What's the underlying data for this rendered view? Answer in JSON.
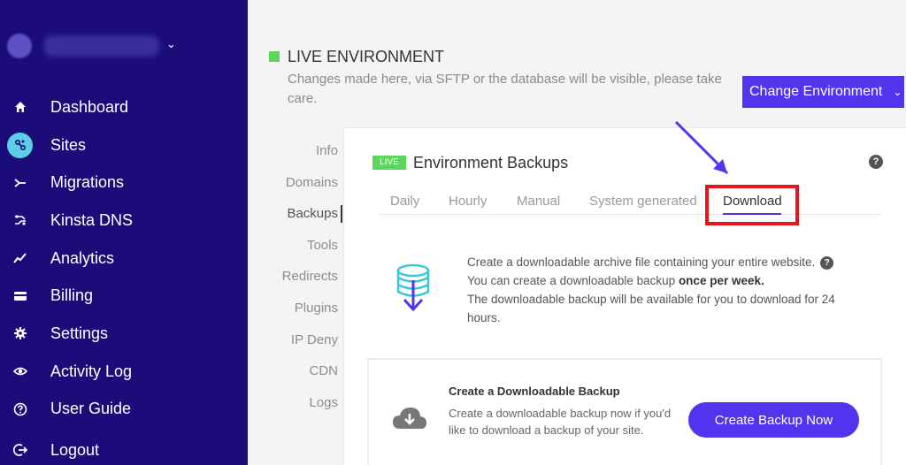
{
  "sidebar": {
    "items": [
      {
        "label": "Dashboard",
        "icon": "home-icon"
      },
      {
        "label": "Sites",
        "icon": "sites-icon",
        "active": true
      },
      {
        "label": "Migrations",
        "icon": "migrations-icon"
      },
      {
        "label": "Kinsta DNS",
        "icon": "dns-icon"
      },
      {
        "label": "Analytics",
        "icon": "analytics-icon"
      },
      {
        "label": "Billing",
        "icon": "billing-icon"
      },
      {
        "label": "Settings",
        "icon": "gear-icon"
      },
      {
        "label": "Activity Log",
        "icon": "eye-icon"
      },
      {
        "label": "User Guide",
        "icon": "question-icon"
      }
    ],
    "logout": "Logout"
  },
  "header": {
    "title": "LIVE ENVIRONMENT",
    "description": "Changes made here, via SFTP or the database will be visible, please take care.",
    "change_env": "Change Environment"
  },
  "subnav": [
    "Info",
    "Domains",
    "Backups",
    "Tools",
    "Redirects",
    "Plugins",
    "IP Deny",
    "CDN",
    "Logs"
  ],
  "card": {
    "badge": "LIVE",
    "title": "Environment Backups",
    "tabs": [
      "Daily",
      "Hourly",
      "Manual",
      "System generated",
      "Download"
    ],
    "info_line1": "Create a downloadable archive file containing your entire website.",
    "info_line2_pre": "You can create a downloadable backup ",
    "info_line2_bold": "once per week.",
    "info_line3": "The downloadable backup will be available for you to download for 24 hours.",
    "dl_title": "Create a Downloadable Backup",
    "dl_desc": "Create a downloadable backup now if you'd like to download a backup of your site.",
    "create_btn": "Create Backup Now"
  },
  "colors": {
    "sidebar": "#1c0c7a",
    "accent": "#5333ed",
    "live": "#5cd65c",
    "highlight": "#e8141b"
  }
}
